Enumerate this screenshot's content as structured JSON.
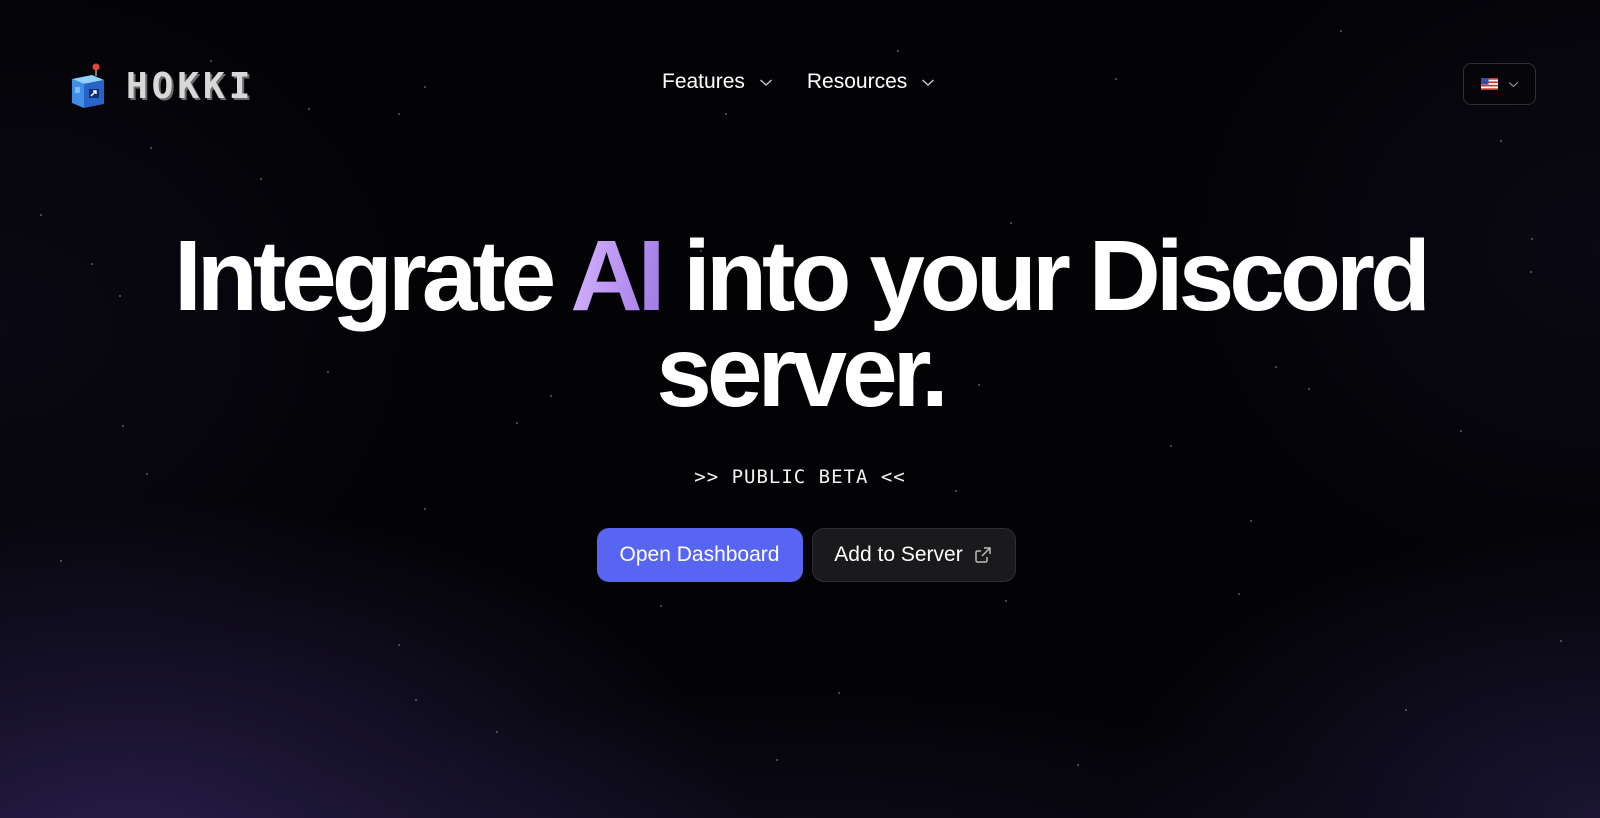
{
  "brand": {
    "name": "HOKKI",
    "logo_icon": "robot-box-icon"
  },
  "nav": {
    "items": [
      {
        "label": "Features",
        "icon": "chevron-down-icon"
      },
      {
        "label": "Resources",
        "icon": "chevron-down-icon"
      }
    ]
  },
  "language": {
    "icon": "us-flag-icon"
  },
  "hero": {
    "headline_pre": "Integrate ",
    "headline_accent": "AI",
    "headline_post": " into your Discord",
    "headline_line2": "server.",
    "tagline": ">> PUBLIC BETA <<"
  },
  "cta": {
    "primary": "Open Dashboard",
    "secondary": "Add to Server",
    "secondary_icon": "external-link-icon"
  },
  "colors": {
    "accent": "#5865f2",
    "ai_gradient_start": "#d8b8ff",
    "ai_gradient_end": "#9f7ae0",
    "background": "#030306"
  }
}
